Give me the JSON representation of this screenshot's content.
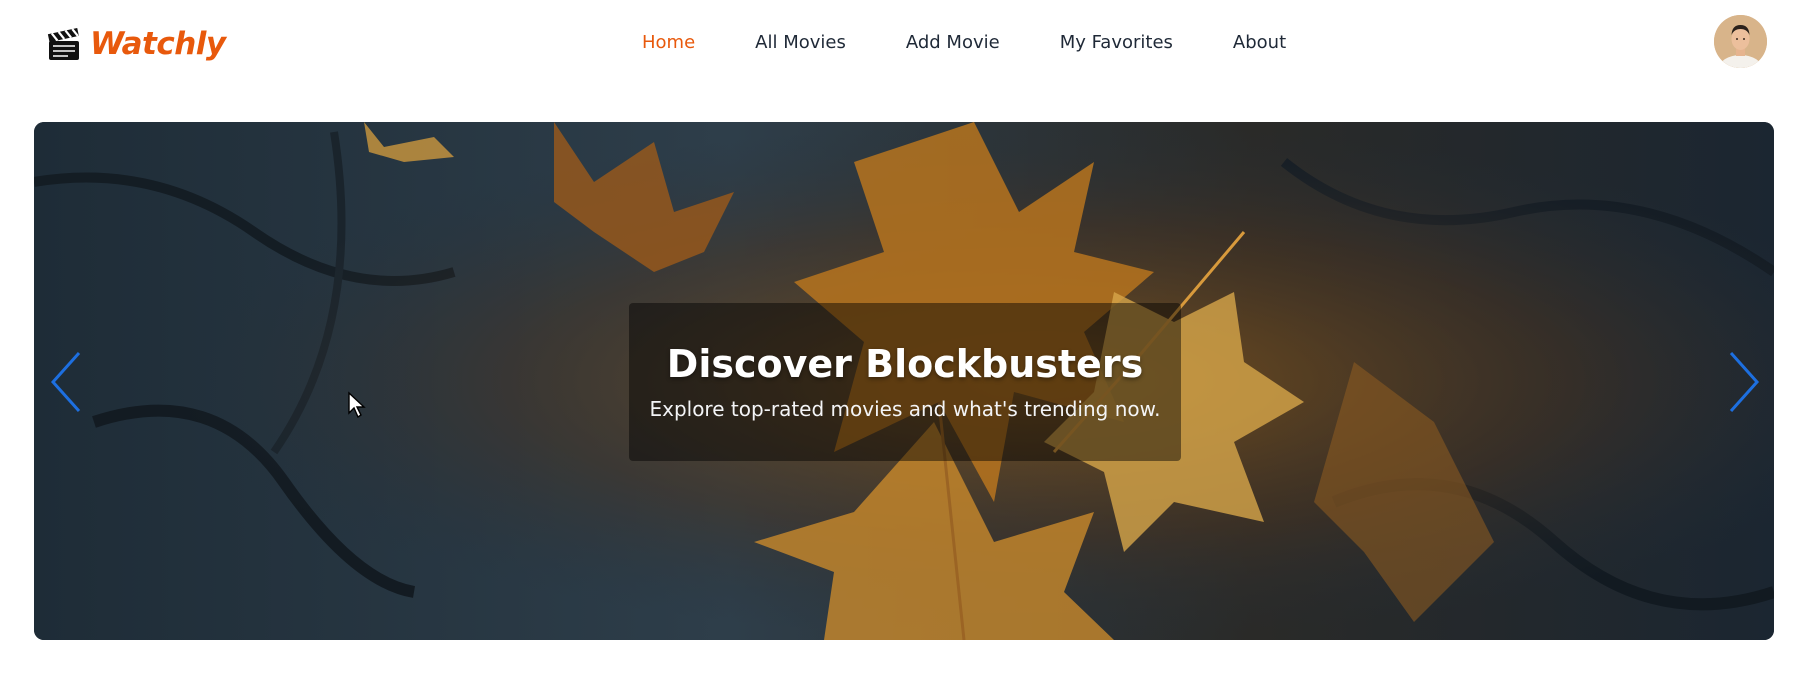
{
  "brand": {
    "name": "Watchly",
    "logo_icon": "clapperboard-icon",
    "accent_color": "#e8590c"
  },
  "nav": {
    "items": [
      {
        "label": "Home",
        "active": true
      },
      {
        "label": "All Movies",
        "active": false
      },
      {
        "label": "Add Movie",
        "active": false
      },
      {
        "label": "My Favorites",
        "active": false
      },
      {
        "label": "About",
        "active": false
      }
    ]
  },
  "user": {
    "avatar_icon": "user-avatar"
  },
  "hero": {
    "title": "Discover Blockbusters",
    "subtitle": "Explore top-rated movies and what's trending now.",
    "prev_icon": "chevron-left-icon",
    "next_icon": "chevron-right-icon",
    "arrow_color": "#1d6fe0"
  }
}
